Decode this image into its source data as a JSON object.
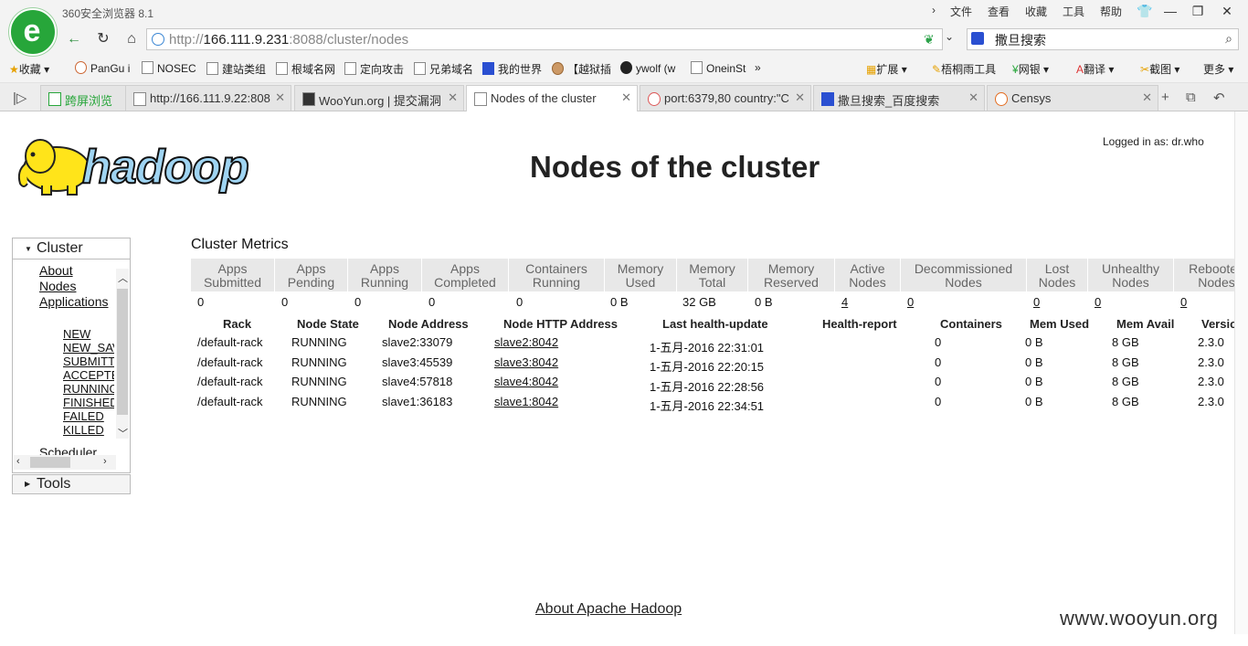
{
  "browser": {
    "app_title": "360安全浏览器 8.1",
    "menu": [
      "文件",
      "查看",
      "收藏",
      "工具",
      "帮助"
    ],
    "url_scheme_host_prefix": "http://",
    "url_host": "166.111.9.231",
    "url_rest": ":8088/cluster/nodes",
    "search_text": "撒旦搜索",
    "bookmarks": [
      "收藏",
      "PanGu i",
      "NOSEC",
      "建站类组",
      "根域名网",
      "定向攻击",
      "兄弟域名",
      "我的世界",
      "【越狱插",
      "ywolf (w",
      "OneinSt"
    ],
    "toolbar_right": [
      "扩展",
      "梧桐雨工具",
      "网银",
      "翻译",
      "截图",
      "更多"
    ],
    "tabs": [
      {
        "label": "跨屏浏览"
      },
      {
        "label": "http://166.111.9.22:808"
      },
      {
        "label": "WooYun.org | 提交漏洞"
      },
      {
        "label": "Nodes of the cluster"
      },
      {
        "label": "port:6379,80 country:\"C"
      },
      {
        "label": "撒旦搜索_百度搜索"
      },
      {
        "label": "Censys"
      }
    ]
  },
  "page": {
    "logo_text": "hadoop",
    "title": "Nodes of the cluster",
    "logged_in": "Logged in as: dr.who",
    "footer_link": "About Apache Hadoop",
    "watermark": "www.wooyun.org"
  },
  "sidebar": {
    "cluster_label": "Cluster",
    "links": [
      "About",
      "Nodes",
      "Applications"
    ],
    "app_states": [
      "NEW",
      "NEW_SAVING",
      "SUBMITTED",
      "ACCEPTED",
      "RUNNING",
      "FINISHED",
      "FAILED",
      "KILLED"
    ],
    "scheduler": "Scheduler",
    "tools_label": "Tools"
  },
  "metrics": {
    "title": "Cluster Metrics",
    "headers": [
      [
        "Apps",
        "Submitted"
      ],
      [
        "Apps",
        "Pending"
      ],
      [
        "Apps",
        "Running"
      ],
      [
        "Apps",
        "Completed"
      ],
      [
        "Containers",
        "Running"
      ],
      [
        "Memory",
        "Used"
      ],
      [
        "Memory",
        "Total"
      ],
      [
        "Memory",
        "Reserved"
      ],
      [
        "Active",
        "Nodes"
      ],
      [
        "Decommissioned",
        "Nodes"
      ],
      [
        "Lost",
        "Nodes"
      ],
      [
        "Unhealthy",
        "Nodes"
      ],
      [
        "Rebooted",
        "Nodes"
      ]
    ],
    "values": [
      "0",
      "0",
      "0",
      "0",
      "0",
      "0 B",
      "32 GB",
      "0 B",
      "4",
      "0",
      "0",
      "0",
      "0"
    ]
  },
  "nodes": {
    "headers": [
      "Rack",
      "Node State",
      "Node Address",
      "Node HTTP Address",
      "Last health-update",
      "Health-report",
      "Containers",
      "Mem Used",
      "Mem Avail",
      "Version"
    ],
    "rows": [
      [
        "/default-rack",
        "RUNNING",
        "slave2:33079",
        "slave2:8042",
        "1-五月-2016 22:31:01",
        "",
        "0",
        "0 B",
        "8 GB",
        "2.3.0"
      ],
      [
        "/default-rack",
        "RUNNING",
        "slave3:45539",
        "slave3:8042",
        "1-五月-2016 22:20:15",
        "",
        "0",
        "0 B",
        "8 GB",
        "2.3.0"
      ],
      [
        "/default-rack",
        "RUNNING",
        "slave4:57818",
        "slave4:8042",
        "1-五月-2016 22:28:56",
        "",
        "0",
        "0 B",
        "8 GB",
        "2.3.0"
      ],
      [
        "/default-rack",
        "RUNNING",
        "slave1:36183",
        "slave1:8042",
        "1-五月-2016 22:34:51",
        "",
        "0",
        "0 B",
        "8 GB",
        "2.3.0"
      ]
    ]
  }
}
